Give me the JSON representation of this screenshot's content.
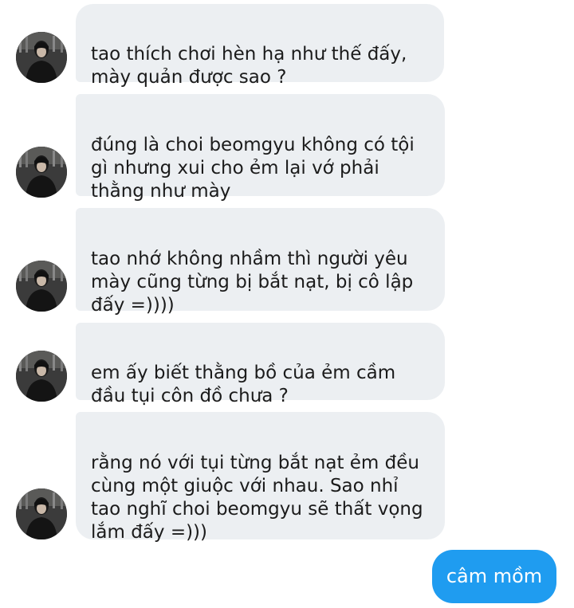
{
  "conversation": {
    "incoming": [
      {
        "text": "tao thích chơi hèn hạ như thế đấy,\nmày quản được sao ?"
      },
      {
        "text": "đúng là choi beomgyu không có tội\ngì nhưng xui cho ẻm lại vớ phải\nthằng như mày"
      },
      {
        "text": "tao nhớ không nhầm thì người yêu\nmày cũng từng bị bắt nạt, bị cô lập\nđấy =))))"
      },
      {
        "text": "em ấy biết thằng bồ của ẻm cầm\nđầu tụi côn đồ chưa ?"
      },
      {
        "text": "rằng nó với tụi từng bắt nạt ẻm đều\ncùng một giuộc với nhau. Sao nhỉ\ntao nghĩ choi beomgyu sẽ thất vọng\nlắm đấy =)))"
      }
    ],
    "outgoing": [
      {
        "text": "câm mồm"
      }
    ]
  },
  "avatar_icon": "user-photo-avatar",
  "colors": {
    "incoming_bubble": "#eceff2",
    "incoming_text": "#1b1b1b",
    "outgoing_bubble": "#1f9cf0",
    "outgoing_text": "#ffffff",
    "background": "#ffffff"
  }
}
